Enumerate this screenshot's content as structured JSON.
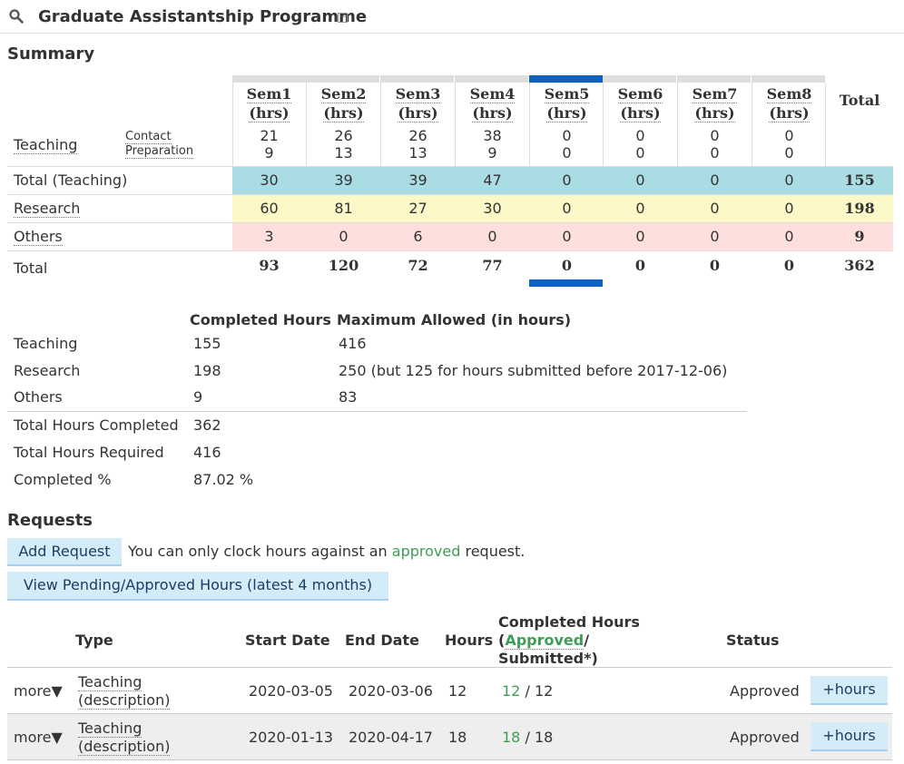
{
  "header": {
    "title": "Graduate Assistantship Programme",
    "search_icon": "search-icon",
    "collapse_icon": "⊟"
  },
  "summary": {
    "title": "Summary",
    "semesters": [
      {
        "name": "Sem1",
        "unit": "(hrs)"
      },
      {
        "name": "Sem2",
        "unit": "(hrs)"
      },
      {
        "name": "Sem3",
        "unit": "(hrs)"
      },
      {
        "name": "Sem4",
        "unit": "(hrs)"
      },
      {
        "name": "Sem5",
        "unit": "(hrs)"
      },
      {
        "name": "Sem6",
        "unit": "(hrs)"
      },
      {
        "name": "Sem7",
        "unit": "(hrs)"
      },
      {
        "name": "Sem8",
        "unit": "(hrs)"
      }
    ],
    "total_header": "Total",
    "current_semester": "Sem5",
    "teaching_label": "Teaching",
    "contact_label": "Contact",
    "preparation_label": "Preparation",
    "contact": [
      "21",
      "26",
      "26",
      "38",
      "0",
      "0",
      "0",
      "0"
    ],
    "preparation": [
      "9",
      "13",
      "13",
      "9",
      "0",
      "0",
      "0",
      "0"
    ],
    "rows": [
      {
        "label": "Total (Teaching)",
        "values": [
          "30",
          "39",
          "39",
          "47",
          "0",
          "0",
          "0",
          "0"
        ],
        "total": "155",
        "color": "#a9dde3"
      },
      {
        "label": "Research",
        "values": [
          "60",
          "81",
          "27",
          "30",
          "0",
          "0",
          "0",
          "0"
        ],
        "total": "198",
        "color": "#fdf8c7"
      },
      {
        "label": "Others",
        "values": [
          "3",
          "0",
          "6",
          "0",
          "0",
          "0",
          "0",
          "0"
        ],
        "total": "9",
        "color": "#fde0de"
      }
    ],
    "grand_total": {
      "label": "Total",
      "values": [
        "93",
        "120",
        "72",
        "77",
        "0",
        "0",
        "0",
        "0"
      ],
      "total": "362"
    },
    "highlight_color": "#0d62c2"
  },
  "completed": {
    "col_completed": "Completed Hours",
    "col_max": "Maximum Allowed (in hours)",
    "rows": [
      {
        "label": "Teaching",
        "value": "155",
        "max": "416"
      },
      {
        "label": "Research",
        "value": "198",
        "max": "250 (but 125 for hours submitted before 2017-12-06)"
      },
      {
        "label": "Others",
        "value": "9",
        "max": "83"
      }
    ],
    "total_completed_label": "Total Hours Completed",
    "total_completed": "362",
    "total_required_label": "Total Hours Required",
    "total_required": "416",
    "percent_label": "Completed %",
    "percent": "87.02 %"
  },
  "requests": {
    "title": "Requests",
    "add_button": "Add Request",
    "note_prefix": "You can only clock hours against an",
    "note_approved": "approved",
    "note_suffix": "request.",
    "view_button": "View Pending/Approved Hours (latest 4 months)",
    "columns": {
      "type": "Type",
      "start": "Start Date",
      "end": "End Date",
      "hours": "Hours",
      "completed_line1": "Completed Hours",
      "completed_open": "(",
      "completed_approved": "Approved",
      "completed_slash": "/",
      "completed_line3": "Submitted*)",
      "status": "Status"
    },
    "rows": [
      {
        "more": "more▼",
        "type": "Teaching",
        "desc": "(description)",
        "start": "2020-03-05",
        "end": "2020-03-06",
        "hours": "12",
        "approved": "12",
        "sep": "/",
        "submitted": "12",
        "status": "Approved",
        "action": "+hours"
      },
      {
        "more": "more▼",
        "type": "Teaching",
        "desc": "(description)",
        "start": "2020-01-13",
        "end": "2020-04-17",
        "hours": "18",
        "approved": "18",
        "sep": "/",
        "submitted": "18",
        "status": "Approved",
        "action": "+hours"
      }
    ]
  }
}
